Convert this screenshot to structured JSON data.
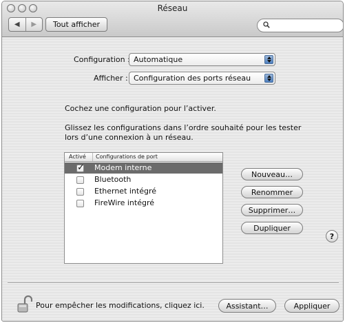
{
  "window": {
    "title": "Réseau"
  },
  "toolbar": {
    "nav_back": "◀",
    "nav_forward": "▶",
    "show_all_label": "Tout afficher",
    "search_placeholder": ""
  },
  "config": {
    "configuration_label": "Configuration :",
    "configuration_value": "Automatique",
    "afficher_label": "Afficher :",
    "afficher_value": "Configuration des ports réseau"
  },
  "instructions": {
    "line1": "Cochez une configuration pour l’activer.",
    "line2": "Glissez les configurations dans l’ordre souhaité pour les tester",
    "line3": "lors d’une connexion à un réseau."
  },
  "table": {
    "headers": [
      "Activé",
      "Configurations de port"
    ],
    "rows": [
      {
        "checked": true,
        "label": "Modem interne",
        "selected": true
      },
      {
        "checked": false,
        "label": "Bluetooth",
        "selected": false
      },
      {
        "checked": false,
        "label": "Ethernet intégré",
        "selected": false
      },
      {
        "checked": false,
        "label": "FireWire intégré",
        "selected": false
      }
    ]
  },
  "actions": {
    "nouveau": "Nouveau…",
    "renommer": "Renommer",
    "supprimer": "Supprimer…",
    "dupliquer": "Dupliquer"
  },
  "help": "?",
  "footer": {
    "lock_text": "Pour empêcher les modifications, cliquez ici.",
    "assistant": "Assistant…",
    "appliquer": "Appliquer"
  }
}
